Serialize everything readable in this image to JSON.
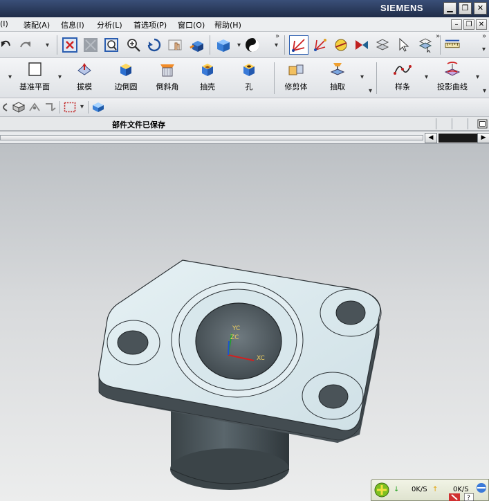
{
  "titlebar": {
    "brand": "SIEMENS",
    "min": "▁",
    "max": "❐",
    "close": "✕"
  },
  "menu": [
    {
      "label": "(I)"
    },
    {
      "label": "装配(A)"
    },
    {
      "label": "信息(I)"
    },
    {
      "label": "分析(L)"
    },
    {
      "label": "首选项(P)"
    },
    {
      "label": "窗口(O)"
    },
    {
      "label": "帮助(H)"
    }
  ],
  "mdi": {
    "min": "–",
    "restore": "❐",
    "close": "✕"
  },
  "feature_tools": [
    {
      "label": "基准平面"
    },
    {
      "label": "拔模"
    },
    {
      "label": "边倒圆"
    },
    {
      "label": "倒斜角"
    },
    {
      "label": "抽壳"
    },
    {
      "label": "孔"
    },
    {
      "label": "修剪体"
    },
    {
      "label": "抽取"
    },
    {
      "label": "样条"
    },
    {
      "label": "投影曲线"
    }
  ],
  "status": {
    "message": "部件文件已保存"
  },
  "axes": {
    "x": "XC",
    "y": "YC",
    "z": "ZC"
  },
  "tray": {
    "down_rate": "0K/S",
    "up_rate": "0K/S"
  },
  "colors": {
    "part_face": "#dbe9ee",
    "part_side": "#4a5358",
    "accent_red": "#d22020"
  }
}
